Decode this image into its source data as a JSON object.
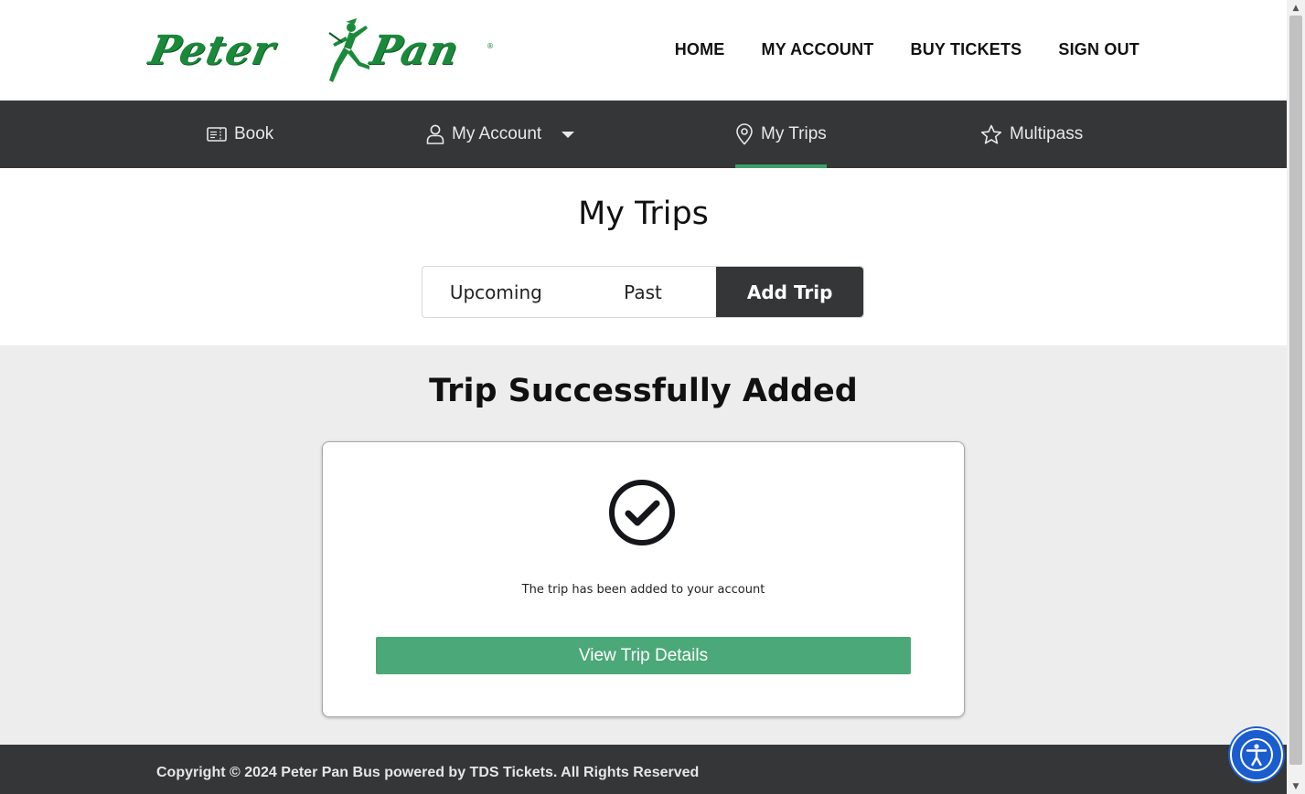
{
  "brand": {
    "logo_left": "Peter",
    "logo_right": "Pan",
    "registered": "®",
    "color": "#1a8a3a"
  },
  "top_nav": {
    "home": "HOME",
    "my_account": "MY ACCOUNT",
    "buy_tickets": "BUY TICKETS",
    "sign_out": "SIGN OUT"
  },
  "sub_nav": {
    "book": {
      "label": "Book",
      "icon": "ticket-icon"
    },
    "my_account": {
      "label": "My Account",
      "icon": "user-icon"
    },
    "my_trips": {
      "label": "My Trips",
      "icon": "map-pin-icon",
      "active": true
    },
    "multipass": {
      "label": "Multipass",
      "icon": "star-icon"
    }
  },
  "main": {
    "title": "My Trips",
    "tabs": [
      {
        "label": "Upcoming",
        "active": false
      },
      {
        "label": "Past",
        "active": false
      },
      {
        "label": "Add Trip",
        "active": true
      }
    ]
  },
  "result": {
    "title": "Trip Successfully Added",
    "message": "The trip has been added to your account",
    "button_label": "View Trip Details",
    "icon": "check-circle-icon"
  },
  "footer": {
    "copyright": "Copyright © 2024 Peter Pan Bus powered by TDS Tickets. All Rights Reserved"
  },
  "colors": {
    "nav_dark": "#343637",
    "accent_green": "#4ba878",
    "active_underline": "#3fa06a",
    "accessibility_blue": "#1a5dcf"
  }
}
